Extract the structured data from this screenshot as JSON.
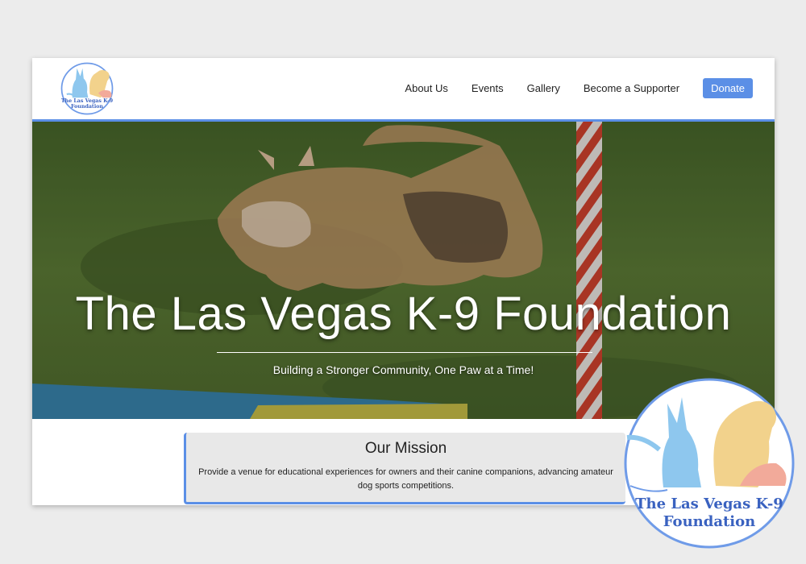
{
  "header": {
    "logo_alt": "The Las Vegas K-9 Foundation logo",
    "nav": [
      {
        "label": "About Us"
      },
      {
        "label": "Events"
      },
      {
        "label": "Gallery"
      },
      {
        "label": "Become a Supporter"
      }
    ],
    "donate_label": "Donate"
  },
  "hero": {
    "title": "The Las Vegas K-9 Foundation",
    "subtitle": "Building a Stronger Community, One Paw at a Time!",
    "slides_count": 4,
    "active_slide": 2
  },
  "mission": {
    "title": "Our Mission",
    "text": "Provide a venue for educational experiences for owners and their canine companions, advancing amateur dog sports competitions."
  },
  "logo": {
    "line1": "The Las Vegas K-9",
    "line2": "Foundation"
  },
  "colors": {
    "accent": "#5b8fe6",
    "grass": "#5d7a3a",
    "dog_blue": "#8ec7ee",
    "dog_gold": "#f2d28c",
    "dog_pink": "#f2aa9a"
  }
}
